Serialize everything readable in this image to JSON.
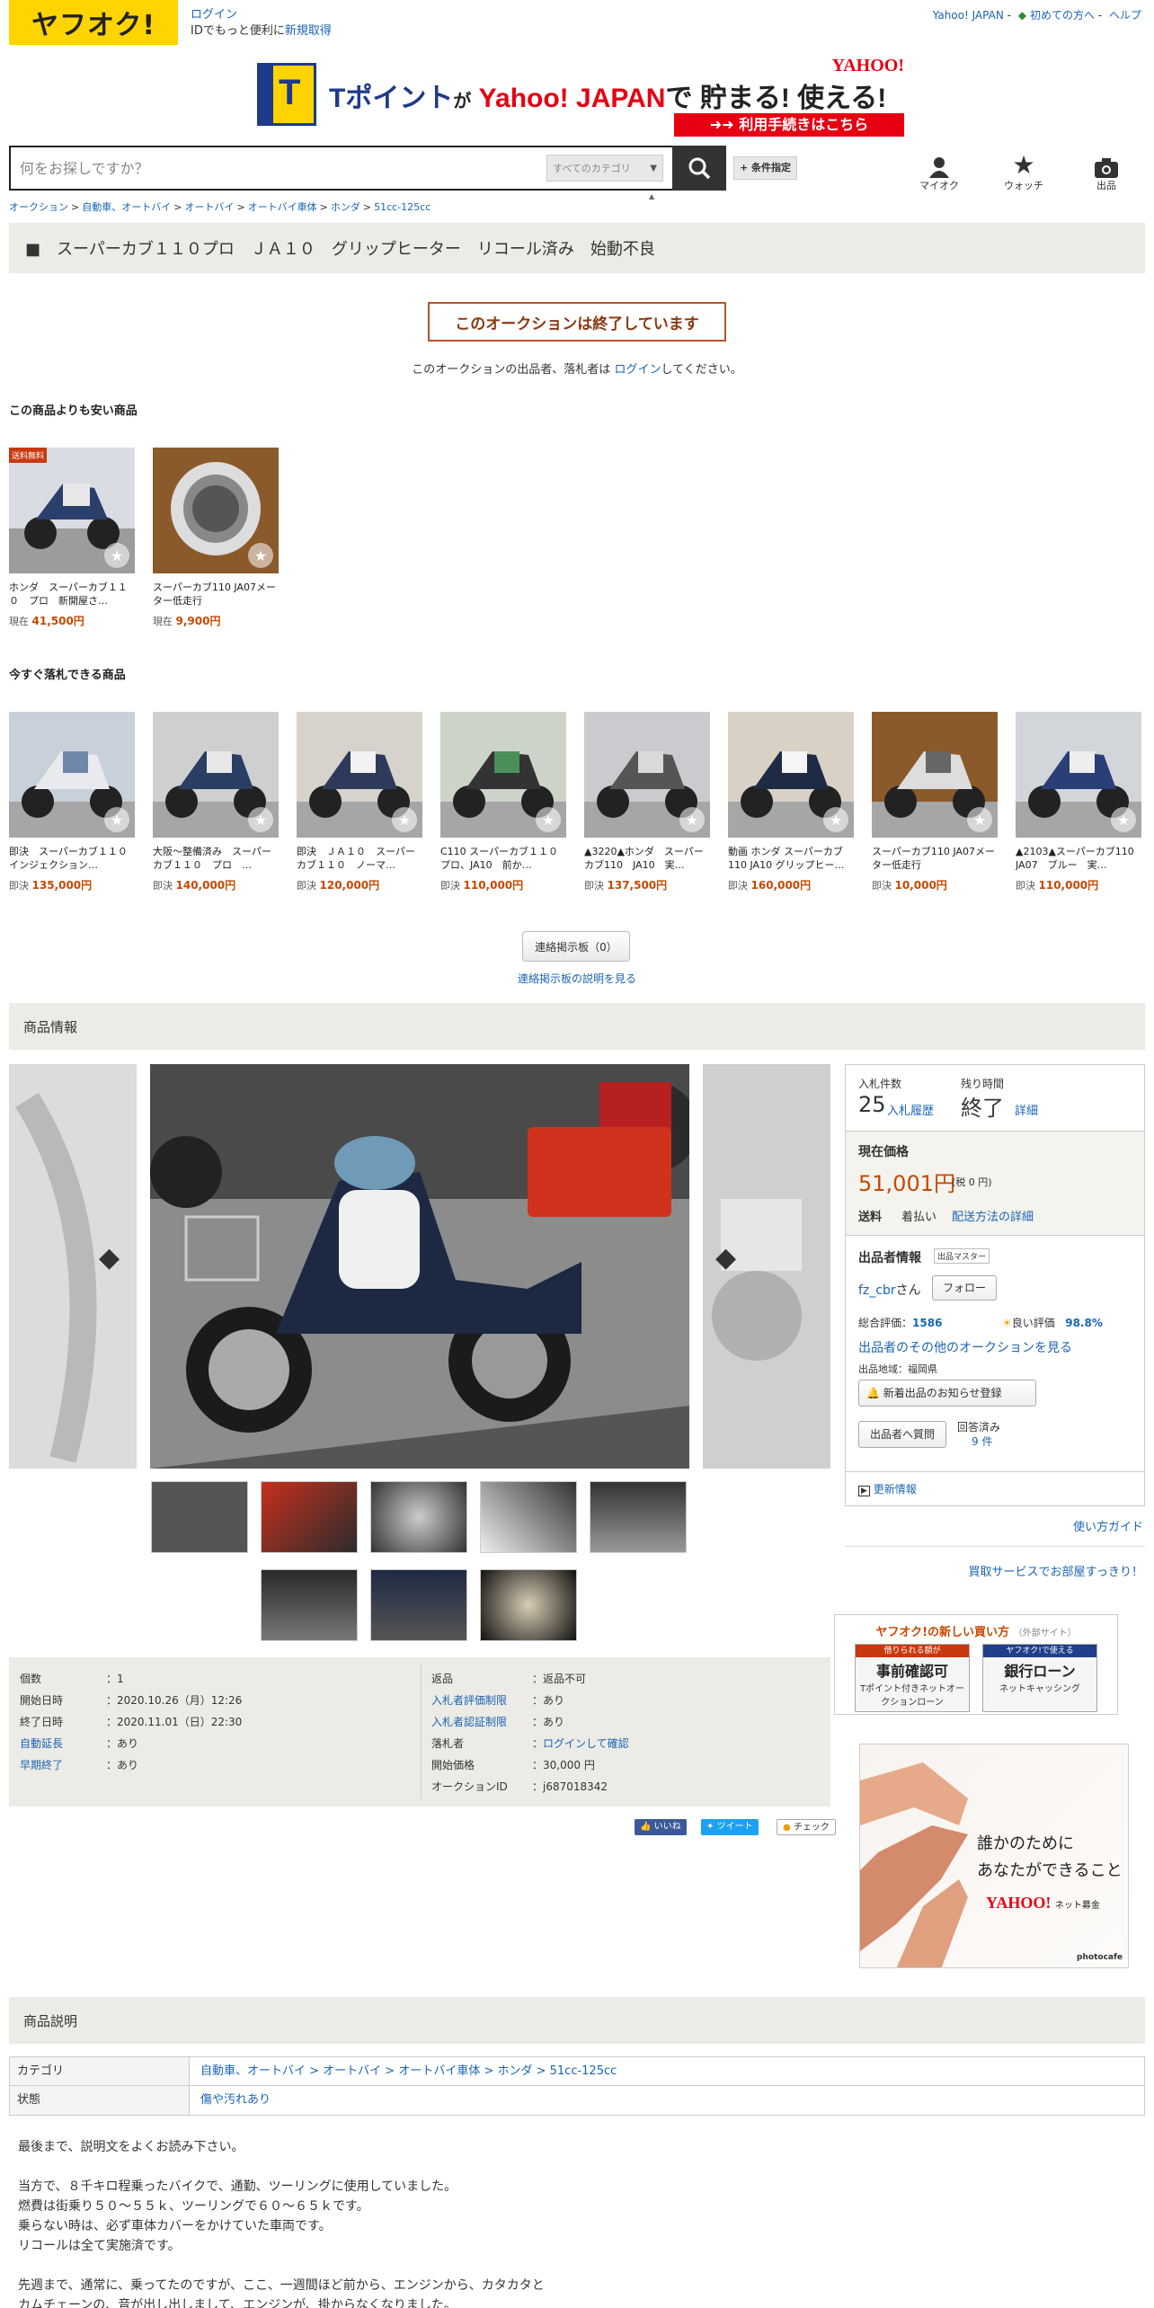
{
  "header": {
    "logo": "ヤフオク!",
    "login_link": "ログイン",
    "login_sub_prefix": "IDでもっと便利に",
    "register_link": "新規取得",
    "top_links": [
      "Yahoo! JAPAN",
      "初めての方へ",
      "ヘルプ"
    ]
  },
  "banner": {
    "t_letter": "T",
    "headline_a": "Tポイント",
    "headline_b": "が",
    "headline_c": "Yahoo! JAPAN",
    "headline_d": "で 貯まる! 使える!",
    "yahoo_logo": "YAHOO!",
    "cta": "利用手続きはこちら"
  },
  "search": {
    "placeholder": "何をお探しですか？",
    "category": "すべてのカテゴリ",
    "conditions": "+ 条件指定"
  },
  "header_icons": [
    {
      "label": "マイオク",
      "icon": "person-icon"
    },
    {
      "label": "ウォッチ",
      "icon": "star-icon"
    },
    {
      "label": "出品",
      "icon": "camera-icon"
    }
  ],
  "breadcrumb": [
    "オークション",
    "自動車、オートバイ",
    "オートバイ",
    "オートバイ車体",
    "ホンダ",
    "51cc-125cc"
  ],
  "title": "■　スーパーカブ１１０プロ　ＪＡ１０　グリップヒーター　リコール済み　始動不良",
  "ended": {
    "message": "このオークションは終了しています",
    "note_prefix": "このオークションの出品者、落札者は",
    "note_link": "ログイン",
    "note_suffix": "してください。"
  },
  "cheaper_section": {
    "heading": "この商品よりも安い商品",
    "items": [
      {
        "name": "ホンダ　スーパーカブ１１０　プロ　新開屋さ…",
        "price_label": "現在",
        "price": "41,500円",
        "badge": "送料無料"
      },
      {
        "name": "スーパーカブ110 JA07メーター低走行",
        "price_label": "現在",
        "price": "9,900円",
        "badge": ""
      }
    ]
  },
  "buynow_section": {
    "heading": "今すぐ落札できる商品",
    "items": [
      {
        "name": "即決　スーパーカブ１１０　インジェクション…",
        "price_label": "即決",
        "price": "135,000円"
      },
      {
        "name": "大阪～整備済み　スーパーカブ１１０　プロ　…",
        "price_label": "即決",
        "price": "140,000円"
      },
      {
        "name": "即決　ＪＡ１０　スーパーカブ１１０　ノーマ…",
        "price_label": "即決",
        "price": "120,000円"
      },
      {
        "name": "C110 スーパーカブ１１０ プロ、JA10　前か…",
        "price_label": "即決",
        "price": "110,000円"
      },
      {
        "name": "▲3220▲ホンダ　スーパーカブ110　JA10　実…",
        "price_label": "即決",
        "price": "137,500円"
      },
      {
        "name": "動画 ホンダ スーパーカブ110 JA10 グリップヒー…",
        "price_label": "即決",
        "price": "160,000円"
      },
      {
        "name": "スーパーカブ110 JA07メーター低走行",
        "price_label": "即決",
        "price": "10,000円"
      },
      {
        "name": "▲2103▲スーパーカブ110　JA07　ブルー　実…",
        "price_label": "即決",
        "price": "110,000円"
      }
    ]
  },
  "board": {
    "button": "連絡掲示板（0）",
    "link": "連絡掲示板の説明を見る"
  },
  "product_info_heading": "商品情報",
  "bid_panel": {
    "bids_label": "入札件数",
    "bids_value": "25",
    "bid_history": "入札履歴",
    "time_label": "残り時間",
    "time_value": "終了",
    "details": "詳細",
    "price_label": "現在価格",
    "price": "51,001円",
    "tax": "(税 0 円)",
    "shipping_label": "送料",
    "shipping_value": "着払い",
    "shipping_link": "配送方法の詳細",
    "seller_heading": "出品者情報",
    "seller_badge": "出品マスター",
    "seller_name": "fz_cbr",
    "seller_suffix": "さん",
    "follow": "フォロー",
    "rating_label": "総合評価：",
    "rating_value": "1586",
    "good_label": "良い評価",
    "good_value": "98.8%",
    "other_auctions": "出品者のその他のオークションを見る",
    "region": "出品地域：福岡県",
    "notify": "新着出品のお知らせ登録",
    "question": "出品者へ質問",
    "answered": "回答済み",
    "answered_count": "9 件",
    "update": "更新情報"
  },
  "right_links": [
    "使い方ガイド",
    "買取サービスでお部屋すっきり！"
  ],
  "howto": {
    "title": "ヤフオク!の新しい買い方",
    "external": "（外部サイト）",
    "card1_ribbon": "借りられる額が",
    "card1_big": "事前確認可",
    "card1_sub": "Tポイント付きネットオークションローン",
    "card2_ribbon": "ヤフオク!で使える",
    "card2_big": "銀行ローン",
    "card2_sub": "ネットキャッシング"
  },
  "ad": {
    "line1": "誰かのために",
    "line2": "あなたができること",
    "logo": "YAHOO!",
    "logo_sub": "ネット募金",
    "credit": "photocafe"
  },
  "info_left": [
    {
      "k": "個数",
      "v": "1",
      "link": false
    },
    {
      "k": "開始日時",
      "v": "2020.10.26（月）12:26",
      "link": false
    },
    {
      "k": "終了日時",
      "v": "2020.11.01（日）22:30",
      "link": false
    },
    {
      "k": "自動延長",
      "v": "あり",
      "link": true
    },
    {
      "k": "早期終了",
      "v": "あり",
      "link": true
    }
  ],
  "info_right": [
    {
      "k": "返品",
      "v": "返品不可",
      "link": false,
      "vlink": false
    },
    {
      "k": "入札者評価制限",
      "v": "あり",
      "link": true,
      "vlink": false
    },
    {
      "k": "入札者認証制限",
      "v": "あり",
      "link": true,
      "vlink": false
    },
    {
      "k": "落札者",
      "v": "ログインして確認",
      "link": false,
      "vlink": true
    },
    {
      "k": "開始価格",
      "v": "30,000 円",
      "link": false,
      "vlink": false
    },
    {
      "k": "オークションID",
      "v": "j687018342",
      "link": false,
      "vlink": false
    }
  ],
  "social": {
    "like": "いいね",
    "tweet": "ツイート",
    "check": "チェック"
  },
  "description": {
    "heading": "商品説明",
    "category_label": "カテゴリ",
    "category_path": "自動車、オートバイ > オートバイ > オートバイ車体 > ホンダ > 51cc-125cc",
    "condition_label": "状態",
    "condition_value": "傷や汚れあり",
    "text": "最後まで、説明文をよくお読み下さい。\n\n当方で、８千キロ程乗ったバイクで、通勤、ツーリングに使用していました。\n燃費は街乗り５０～５５ｋ、ツーリングで６０～６５ｋです。\n乗らない時は、必ず車体カバーをかけていた車両です。\nリコールは全て実施済です。\n\n先週まで、通常に、乗ってたのですが、ここ、一週間ほど前から、エンジンから、カタカタと\nカムチェーンの、音が出し出しまして、エンジンが、掛からなくなりました。"
  },
  "colors": {
    "brand_yellow": "#ffd400",
    "link": "#1a64b4",
    "price": "#c74900",
    "band": "#ecebe6"
  }
}
